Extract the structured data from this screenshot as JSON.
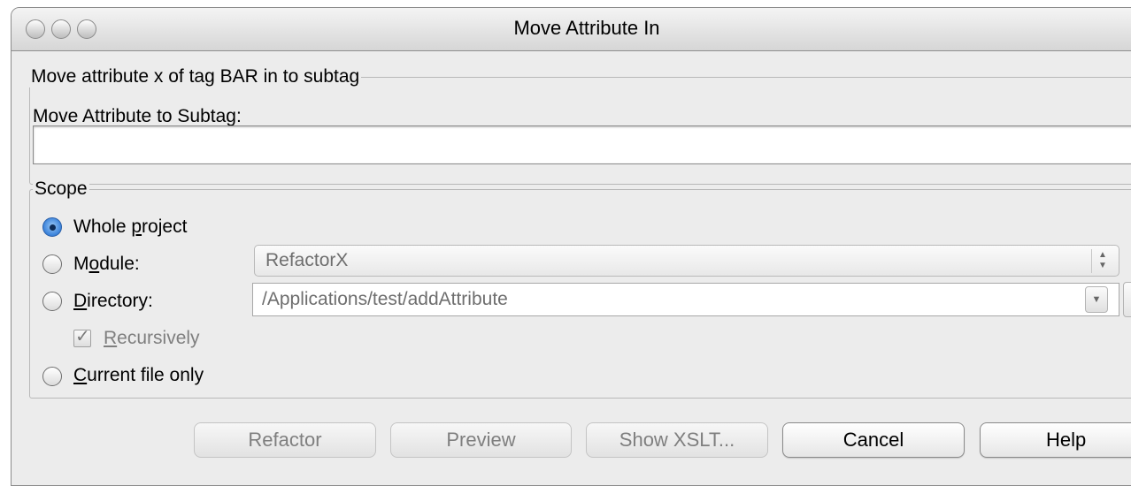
{
  "window": {
    "title": "Move Attribute In"
  },
  "subtag_group": {
    "legend": "Move attribute x of tag BAR in to subtag",
    "field_label": "Move Attribute to Subtag:",
    "field_value": ""
  },
  "scope": {
    "legend": "Scope",
    "options": [
      {
        "pre": "Whole ",
        "mn": "p",
        "post": "roject",
        "checked": true
      },
      {
        "pre": "M",
        "mn": "o",
        "post": "dule:",
        "checked": false
      },
      {
        "pre": "",
        "mn": "D",
        "post": "irectory:",
        "checked": false
      },
      {
        "pre": "",
        "mn": "C",
        "post": "urrent file only",
        "checked": false
      }
    ],
    "module_value": "RefactorX",
    "directory_value": "/Applications/test/addAttribute",
    "recursively": {
      "pre": "",
      "mn": "R",
      "post": "ecursively",
      "checked": true
    }
  },
  "buttons": {
    "refactor": "Refactor",
    "preview": "Preview",
    "show_xslt": "Show XSLT...",
    "cancel": "Cancel",
    "help": "Help"
  }
}
